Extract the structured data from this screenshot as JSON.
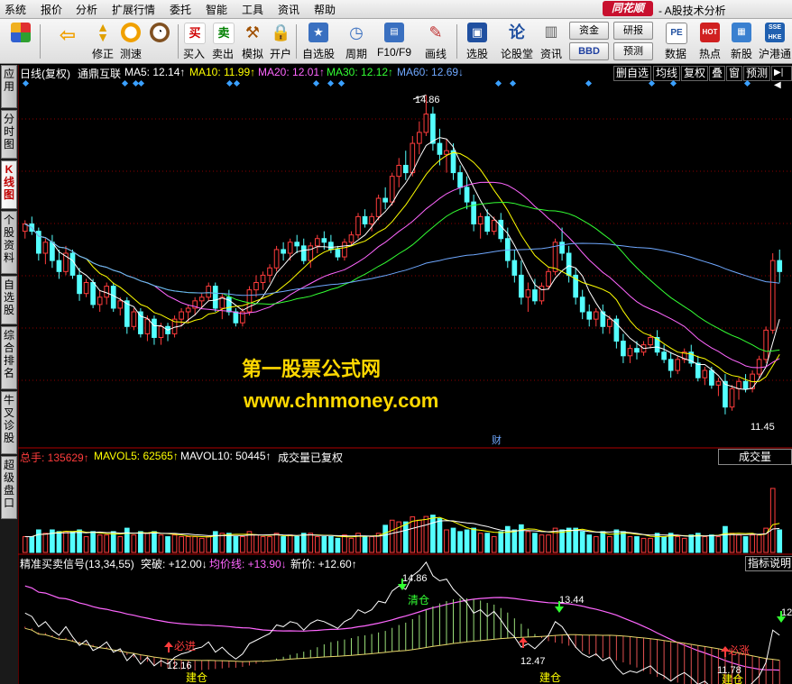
{
  "menubar": {
    "items": [
      "系统",
      "报价",
      "分析",
      "扩展行情",
      "委托",
      "智能",
      "工具",
      "资讯",
      "帮助"
    ],
    "brand": "同花顺",
    "title": "- A股技术分析"
  },
  "toolbar": {
    "buttons": [
      {
        "label": "",
        "icon": "grid-icon"
      },
      {
        "label": "",
        "icon": "back-arrow-icon"
      },
      {
        "label": "修正",
        "icon": "up-down-arrow-icon"
      },
      {
        "label": "测速",
        "icon": "speed-icon"
      },
      {
        "label": "买入",
        "icon": "buy-icon",
        "glyph": "买"
      },
      {
        "label": "卖出",
        "icon": "sell-icon",
        "glyph": "卖"
      },
      {
        "label": "模拟",
        "icon": "simulate-icon"
      },
      {
        "label": "开户",
        "icon": "lock-icon"
      },
      {
        "label": "自选股",
        "icon": "star-icon"
      },
      {
        "label": "周期",
        "icon": "clock-icon"
      },
      {
        "label": "F10/F9",
        "icon": "f10-icon"
      },
      {
        "label": "画线",
        "icon": "pencil-icon"
      },
      {
        "label": "选股",
        "icon": "screen-icon"
      },
      {
        "label": "论股堂",
        "icon": "forum-icon"
      },
      {
        "label": "资讯",
        "icon": "news-icon"
      },
      {
        "label": "数据",
        "icon": "data-icon",
        "glyph": "PE"
      },
      {
        "label": "热点",
        "icon": "hot-icon",
        "glyph": "HOT"
      },
      {
        "label": "新股",
        "icon": "newstock-icon"
      },
      {
        "label": "沪港通",
        "icon": "hkconnect-icon"
      }
    ],
    "small_buttons": [
      "资金",
      "研报",
      "BBD",
      "预测"
    ]
  },
  "sidetabs": [
    "应用",
    "分时图",
    "K线图",
    "个股资料",
    "自选股",
    "综合排名",
    "牛叉诊股",
    "超级盘口"
  ],
  "kline_header": {
    "period": "日线(复权)",
    "stock": "通鼎互联",
    "ma5": "MA5: 12.14↑",
    "ma10": "MA10: 11.99↑",
    "ma20": "MA20: 12.01↑",
    "ma30": "MA30: 12.12↑",
    "ma60": "MA60: 12.69↓",
    "buttons": [
      "删自选",
      "均线",
      "复权",
      "叠",
      "窗",
      "预测",
      "▶|◀"
    ]
  },
  "volume_header": {
    "total": "总手: 135629↑",
    "mavol5": "MAVOL5: 62565↑",
    "mavol10": "MAVOL10: 50445↑",
    "note": "成交量已复权",
    "box": "成交量"
  },
  "indicator_header": {
    "name": "精准买卖信号(13,34,55)",
    "breakout": "突破: +12.00↓",
    "avgline": "均价线: +13.90↓",
    "newprice": "新价: +12.60↑",
    "box": "指标说明"
  },
  "watermark": {
    "line1": "第一股票公式网",
    "line2": "www.chnmoney.com"
  },
  "kline_annotations": {
    "high": "14.86",
    "low": "11.45",
    "fin": "财"
  },
  "indicator_labels": {
    "peak1": "14.86",
    "peak2": "13.44",
    "trough1": "12.16",
    "trough2": "12.47",
    "trough3": "11.78",
    "buy1": "必进",
    "buy2": "必涨",
    "sell1": "清仓",
    "build1": "建仓",
    "build2": "建仓",
    "build3": "建仓",
    "last": "12"
  },
  "colors": {
    "up": "#ff3c3c",
    "down": "#54ffff",
    "ma5": "#ffffff",
    "ma10": "#ffff00",
    "ma20": "#ff66ff",
    "ma30": "#33ff33",
    "ma60": "#6fa8ff",
    "grid": "#8b0000",
    "accent": "#c8102e"
  },
  "chart_data": {
    "type": "candlestick",
    "title": "通鼎互联 日线(复权)",
    "candles": [
      [
        13.0,
        13.15,
        12.9,
        13.1
      ],
      [
        13.1,
        13.2,
        12.95,
        13.0
      ],
      [
        13.0,
        13.05,
        12.6,
        12.7
      ],
      [
        12.7,
        12.9,
        12.55,
        12.85
      ],
      [
        12.85,
        12.95,
        12.5,
        12.6
      ],
      [
        12.6,
        12.75,
        12.35,
        12.45
      ],
      [
        12.45,
        12.8,
        12.4,
        12.7
      ],
      [
        12.7,
        12.75,
        12.35,
        12.4
      ],
      [
        12.4,
        12.5,
        12.05,
        12.15
      ],
      [
        12.15,
        12.35,
        12.1,
        12.3
      ],
      [
        12.3,
        12.35,
        11.95,
        12.0
      ],
      [
        12.0,
        12.2,
        11.9,
        12.1
      ],
      [
        12.1,
        12.3,
        12.0,
        12.25
      ],
      [
        12.25,
        12.3,
        11.9,
        11.95
      ],
      [
        11.95,
        12.1,
        11.85,
        12.05
      ],
      [
        12.05,
        12.1,
        11.6,
        11.7
      ],
      [
        11.7,
        11.95,
        11.65,
        11.9
      ],
      [
        11.9,
        11.95,
        11.55,
        11.6
      ],
      [
        11.6,
        11.85,
        11.5,
        11.8
      ],
      [
        11.8,
        11.85,
        11.45,
        11.55
      ],
      [
        11.55,
        11.75,
        11.45,
        11.7
      ],
      [
        11.7,
        11.75,
        11.5,
        11.6
      ],
      [
        11.6,
        11.85,
        11.55,
        11.8
      ],
      [
        11.8,
        11.95,
        11.7,
        11.9
      ],
      [
        11.9,
        12.0,
        11.75,
        11.95
      ],
      [
        11.95,
        12.1,
        11.85,
        12.05
      ],
      [
        12.05,
        12.15,
        11.95,
        12.1
      ],
      [
        12.1,
        12.3,
        12.05,
        12.25
      ],
      [
        12.25,
        12.3,
        11.9,
        11.95
      ],
      [
        11.95,
        12.15,
        11.8,
        12.1
      ],
      [
        12.1,
        12.2,
        11.85,
        11.9
      ],
      [
        11.9,
        11.95,
        11.7,
        11.75
      ],
      [
        11.75,
        11.95,
        11.7,
        11.9
      ],
      [
        11.9,
        12.25,
        11.85,
        12.2
      ],
      [
        12.2,
        12.4,
        12.1,
        12.3
      ],
      [
        12.3,
        12.45,
        12.2,
        12.4
      ],
      [
        12.4,
        12.55,
        12.3,
        12.5
      ],
      [
        12.5,
        12.8,
        12.45,
        12.75
      ],
      [
        12.75,
        12.85,
        12.6,
        12.7
      ],
      [
        12.7,
        12.9,
        12.6,
        12.85
      ],
      [
        12.85,
        12.95,
        12.7,
        12.8
      ],
      [
        12.8,
        12.9,
        12.55,
        12.6
      ],
      [
        12.6,
        12.85,
        12.5,
        12.8
      ],
      [
        12.8,
        12.95,
        12.7,
        12.9
      ],
      [
        12.9,
        13.0,
        12.75,
        12.85
      ],
      [
        12.85,
        12.95,
        12.7,
        12.75
      ],
      [
        12.75,
        12.8,
        12.6,
        12.65
      ],
      [
        12.65,
        12.9,
        12.6,
        12.85
      ],
      [
        12.85,
        13.0,
        12.8,
        12.95
      ],
      [
        12.95,
        13.25,
        12.9,
        13.2
      ],
      [
        13.2,
        13.3,
        13.05,
        13.1
      ],
      [
        13.1,
        13.25,
        13.0,
        13.2
      ],
      [
        13.2,
        13.5,
        13.15,
        13.45
      ],
      [
        13.45,
        13.6,
        13.3,
        13.4
      ],
      [
        13.4,
        13.8,
        13.35,
        13.75
      ],
      [
        13.75,
        14.0,
        13.6,
        13.9
      ],
      [
        13.9,
        14.1,
        13.7,
        13.8
      ],
      [
        13.8,
        14.3,
        13.75,
        14.2
      ],
      [
        14.2,
        14.5,
        14.05,
        14.35
      ],
      [
        14.35,
        14.86,
        14.3,
        14.6
      ],
      [
        14.6,
        14.7,
        14.1,
        14.2
      ],
      [
        14.2,
        14.4,
        13.9,
        14.05
      ],
      [
        14.05,
        14.25,
        13.8,
        14.1
      ],
      [
        14.1,
        14.2,
        13.7,
        13.8
      ],
      [
        13.8,
        13.9,
        13.5,
        13.6
      ],
      [
        13.6,
        13.75,
        13.3,
        13.4
      ],
      [
        13.4,
        13.5,
        13.0,
        13.1
      ],
      [
        13.1,
        13.25,
        12.9,
        13.2
      ],
      [
        13.2,
        13.3,
        12.95,
        13.0
      ],
      [
        13.0,
        13.2,
        12.95,
        13.15
      ],
      [
        13.15,
        13.25,
        12.85,
        12.9
      ],
      [
        12.9,
        13.05,
        12.5,
        12.6
      ],
      [
        12.6,
        12.75,
        12.3,
        12.4
      ],
      [
        12.4,
        12.6,
        12.0,
        12.1
      ],
      [
        12.1,
        12.3,
        11.9,
        12.2
      ],
      [
        12.2,
        12.35,
        12.0,
        12.05
      ],
      [
        12.05,
        12.3,
        12.0,
        12.25
      ],
      [
        12.25,
        12.5,
        12.2,
        12.45
      ],
      [
        12.45,
        12.9,
        12.4,
        12.85
      ],
      [
        12.85,
        13.05,
        12.6,
        12.7
      ],
      [
        12.7,
        12.8,
        12.3,
        12.4
      ],
      [
        12.4,
        12.5,
        12.0,
        12.1
      ],
      [
        12.1,
        12.2,
        11.8,
        11.9
      ],
      [
        11.9,
        12.0,
        11.7,
        11.8
      ],
      [
        11.8,
        11.95,
        11.7,
        11.9
      ],
      [
        11.9,
        12.0,
        11.6,
        11.7
      ],
      [
        11.7,
        11.85,
        11.6,
        11.8
      ],
      [
        11.8,
        11.85,
        11.4,
        11.5
      ],
      [
        11.5,
        11.6,
        11.2,
        11.3
      ],
      [
        11.3,
        11.45,
        11.2,
        11.4
      ],
      [
        11.4,
        11.5,
        11.25,
        11.35
      ],
      [
        11.35,
        11.5,
        11.3,
        11.45
      ],
      [
        11.45,
        11.6,
        11.4,
        11.55
      ],
      [
        11.55,
        11.65,
        11.3,
        11.35
      ],
      [
        11.35,
        11.45,
        11.2,
        11.25
      ],
      [
        11.25,
        11.35,
        11.0,
        11.1
      ],
      [
        11.1,
        11.3,
        11.05,
        11.25
      ],
      [
        11.25,
        11.4,
        11.2,
        11.35
      ],
      [
        11.35,
        11.45,
        11.15,
        11.2
      ],
      [
        11.2,
        11.3,
        10.95,
        11.0
      ],
      [
        11.0,
        11.15,
        10.9,
        11.1
      ],
      [
        11.1,
        11.15,
        10.85,
        10.9
      ],
      [
        10.9,
        11.0,
        10.75,
        10.95
      ],
      [
        10.95,
        11.05,
        10.5,
        10.6
      ],
      [
        10.6,
        10.9,
        10.55,
        10.85
      ],
      [
        10.85,
        11.0,
        10.7,
        10.95
      ],
      [
        10.95,
        11.05,
        10.8,
        10.85
      ],
      [
        10.85,
        11.1,
        10.8,
        11.05
      ],
      [
        11.05,
        11.3,
        11.0,
        11.25
      ],
      [
        11.25,
        11.7,
        11.2,
        11.65
      ],
      [
        11.65,
        12.7,
        11.6,
        12.6
      ],
      [
        12.6,
        12.75,
        12.3,
        12.45
      ]
    ],
    "volume": {
      "mavol5": 62565,
      "mavol10": 50445,
      "total": 135629
    },
    "indicator": {
      "name": "精准买卖信号",
      "params": [
        13,
        34,
        55
      ],
      "breakout": 12.0,
      "avg": 13.9,
      "new": 12.6
    }
  }
}
